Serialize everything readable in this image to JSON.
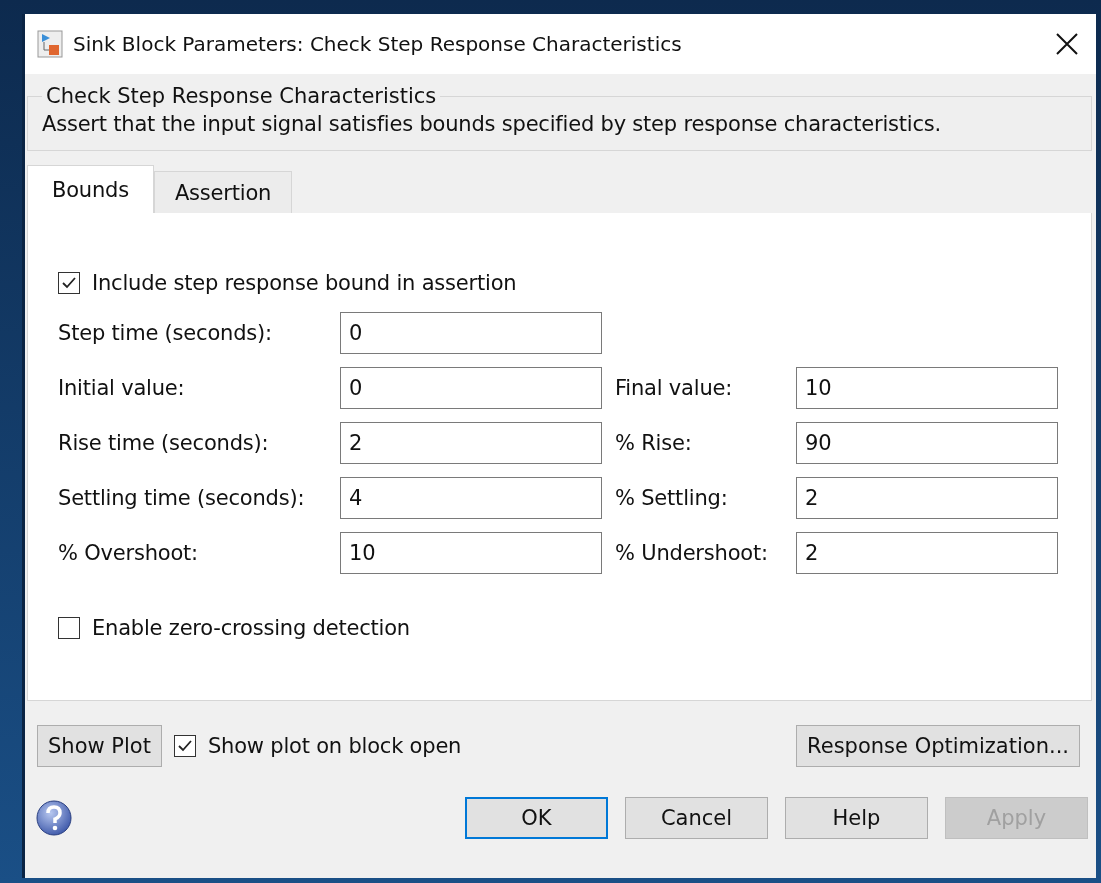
{
  "window": {
    "title": "Sink Block Parameters: Check Step Response Characteristics"
  },
  "group": {
    "title": "Check Step Response Characteristics",
    "description": "Assert that the input signal satisfies bounds specified by step response characteristics."
  },
  "tabs": [
    {
      "label": "Bounds",
      "selected": true
    },
    {
      "label": "Assertion",
      "selected": false
    }
  ],
  "include_bound": {
    "label": "Include step response bound in assertion",
    "checked": true
  },
  "parameters": [
    {
      "label": "Step time (seconds):",
      "value": "0"
    },
    {
      "label": "Initial value:",
      "value": "0",
      "right_label": "Final value:",
      "right_value": "10"
    },
    {
      "label": "Rise time (seconds):",
      "value": "2",
      "right_label": "% Rise:",
      "right_value": "90"
    },
    {
      "label": "Settling time (seconds):",
      "value": "4",
      "right_label": "% Settling:",
      "right_value": "2"
    },
    {
      "label": "% Overshoot:",
      "value": "10",
      "right_label": "% Undershoot:",
      "right_value": "2"
    }
  ],
  "zero_crossing": {
    "label": "Enable zero-crossing detection",
    "checked": false
  },
  "show_plot_button": "Show Plot",
  "show_plot_on_open": {
    "label": "Show plot on block open",
    "checked": true
  },
  "response_optimization_button": "Response Optimization...",
  "buttons": [
    {
      "label": "OK",
      "focused": true,
      "disabled": false
    },
    {
      "label": "Cancel",
      "focused": false,
      "disabled": false
    },
    {
      "label": "Help",
      "focused": false,
      "disabled": false
    },
    {
      "label": "Apply",
      "focused": false,
      "disabled": true
    }
  ]
}
